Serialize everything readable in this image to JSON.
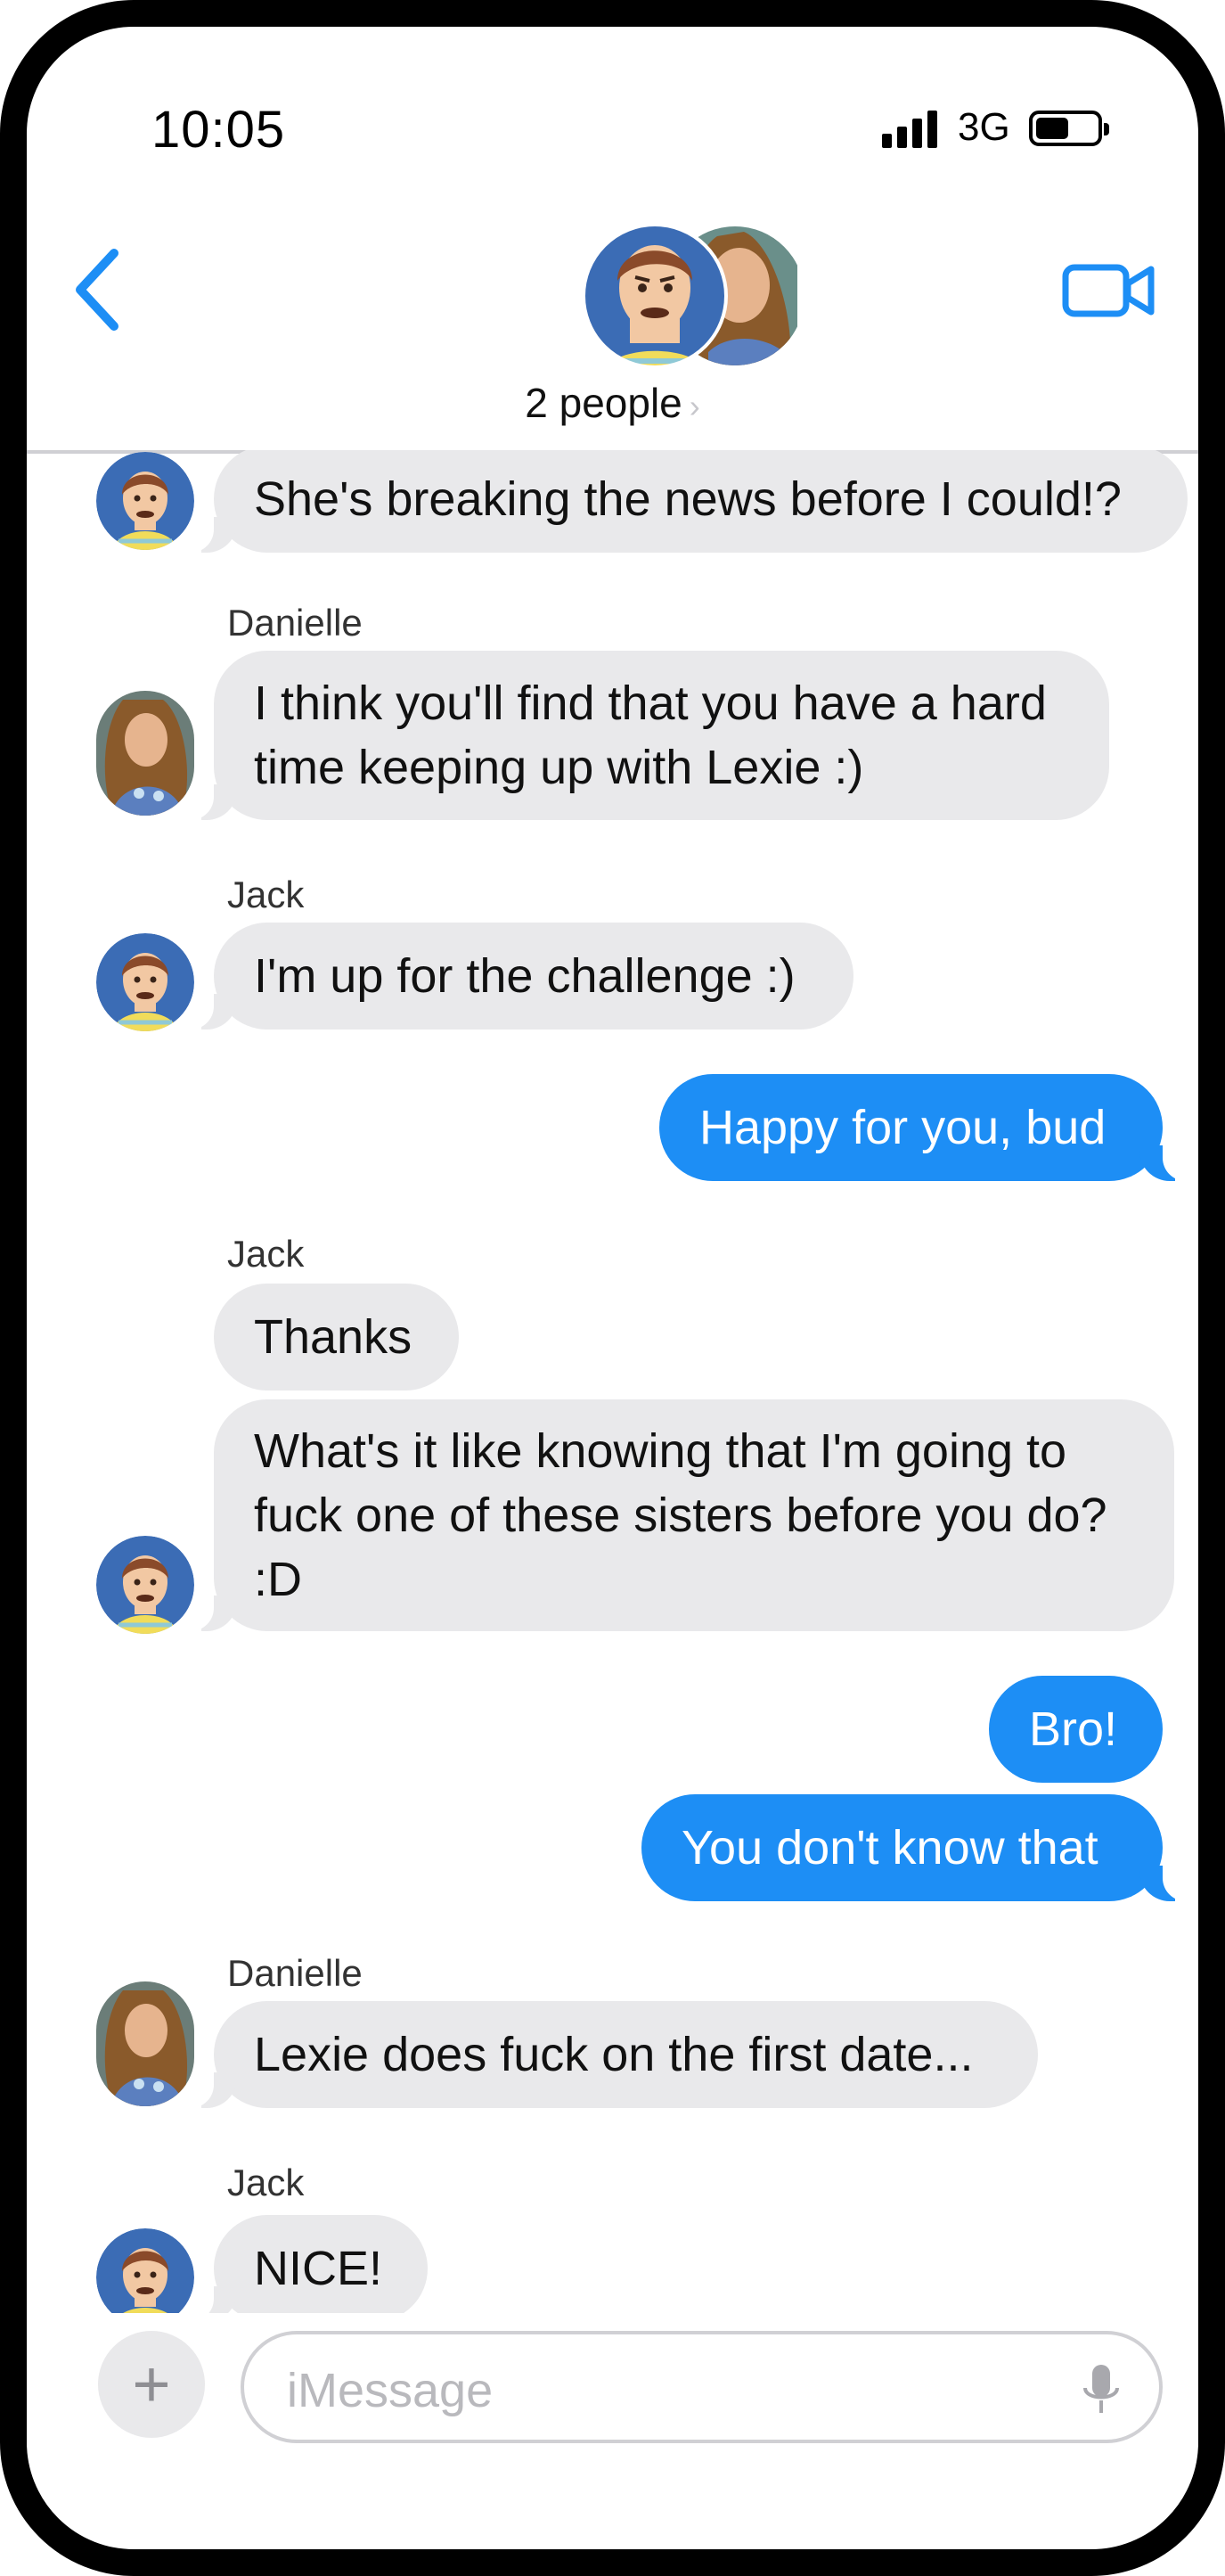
{
  "status_bar": {
    "time": "10:05",
    "network": "3G"
  },
  "header": {
    "title": "2 people",
    "chevron": "›"
  },
  "icons": {
    "back": "chevron-left-icon",
    "video": "video-camera-icon",
    "add": "plus-icon",
    "mic": "microphone-icon",
    "accent": "#1d8ef5"
  },
  "messages": [
    {
      "from": "Jack",
      "show_name": false,
      "text": "She's breaking the news before I could!?"
    },
    {
      "from": "Danielle",
      "show_name": true,
      "name": "Danielle",
      "text": "I think you'll find that you have a hard time keeping up with Lexie :)"
    },
    {
      "from": "Jack",
      "show_name": true,
      "name": "Jack",
      "text": "I'm up for the challenge :)"
    },
    {
      "from": "me",
      "text": "Happy for you, bud"
    },
    {
      "from": "Jack",
      "show_name": true,
      "name": "Jack",
      "text": "Thanks"
    },
    {
      "from": "Jack",
      "show_name": false,
      "text": "What's it like knowing that I'm going to fuck one of these sisters before you do? :D"
    },
    {
      "from": "me",
      "text": "Bro!"
    },
    {
      "from": "me",
      "text": "You don't know that"
    },
    {
      "from": "Danielle",
      "show_name": true,
      "name": "Danielle",
      "text": "Lexie does fuck on the first date..."
    },
    {
      "from": "Jack",
      "show_name": true,
      "name": "Jack",
      "text": "NICE!"
    }
  ],
  "composer": {
    "placeholder": "iMessage",
    "plus": "+"
  }
}
